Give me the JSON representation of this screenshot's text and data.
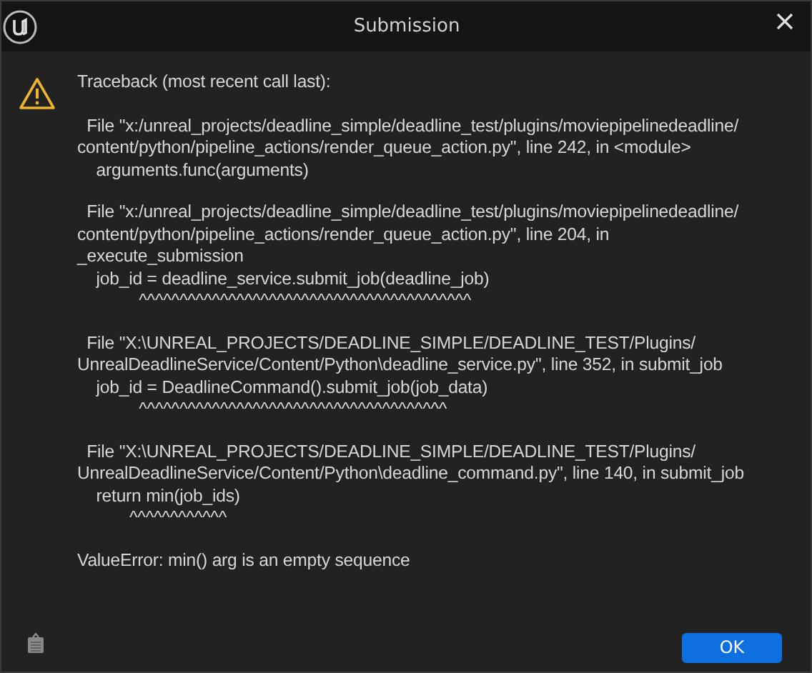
{
  "window": {
    "title": "Submission"
  },
  "message": {
    "blocks": [
      [
        "Traceback (most recent call last):"
      ],
      [
        "  File \"x:/unreal_projects/deadline_simple/deadline_test/plugins/moviepipelinedeadline/",
        "content/python/pipeline_actions/render_queue_action.py\", line 242, in <module>",
        "    arguments.func(arguments)"
      ],
      [
        "  File \"x:/unreal_projects/deadline_simple/deadline_test/plugins/moviepipelinedeadline/",
        "content/python/pipeline_actions/render_queue_action.py\", line 204, in",
        "_execute_submission",
        "    job_id = deadline_service.submit_job(deadline_job)",
        "             ^^^^^^^^^^^^^^^^^^^^^^^^^^^^^^^^^^^^^^^^^"
      ],
      [
        "  File \"X:\\UNREAL_PROJECTS/DEADLINE_SIMPLE/DEADLINE_TEST/Plugins/",
        "UnrealDeadlineService/Content/Python\\deadline_service.py\", line 352, in submit_job",
        "    job_id = DeadlineCommand().submit_job(job_data)",
        "             ^^^^^^^^^^^^^^^^^^^^^^^^^^^^^^^^^^^^^^"
      ],
      [
        "  File \"X:\\UNREAL_PROJECTS/DEADLINE_SIMPLE/DEADLINE_TEST/Plugins/",
        "UnrealDeadlineService/Content/Python\\deadline_command.py\", line 140, in submit_job",
        "    return min(job_ids)",
        "           ^^^^^^^^^^^^"
      ],
      [
        "ValueError: min() arg is an empty sequence"
      ]
    ]
  },
  "buttons": [
    {
      "label": "OK",
      "kind": "primary"
    }
  ]
}
